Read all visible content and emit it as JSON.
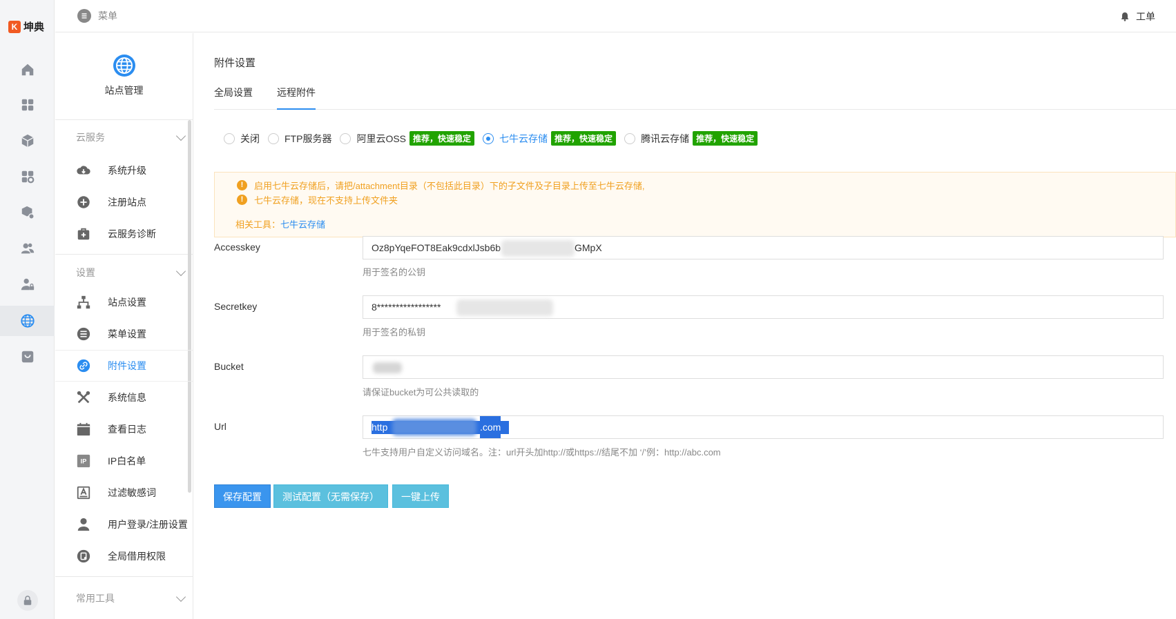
{
  "app": {
    "logo_mark": "K",
    "logo_name": "坤典"
  },
  "rail": {
    "icons": [
      "home-icon",
      "apps-grid-icon",
      "cube-icon",
      "apps-settings-icon",
      "box-settings-icon",
      "users-icon",
      "user-lock-icon",
      "globe-icon",
      "store-icon",
      "lock-icon"
    ],
    "active_index": 7
  },
  "topbar": {
    "menu_label": "菜单",
    "ticket_label": "工单"
  },
  "sidebar": {
    "header_title": "站点管理",
    "groups": [
      {
        "label": "云服务",
        "items": [
          "系统升级",
          "注册站点",
          "云服务诊断"
        ]
      },
      {
        "label": "设置",
        "items": [
          "站点设置",
          "菜单设置",
          "附件设置",
          "系统信息",
          "查看日志",
          "IP白名单",
          "过滤敏感词",
          "用户登录/注册设置",
          "全局借用权限"
        ]
      },
      {
        "label": "常用工具",
        "items": []
      }
    ],
    "active_item": "附件设置"
  },
  "main": {
    "title": "附件设置",
    "tabs": [
      "全局设置",
      "远程附件"
    ],
    "active_tab": "远程附件",
    "storage_options": [
      {
        "label": "关闭",
        "badge": "",
        "checked": false
      },
      {
        "label": "FTP服务器",
        "badge": "",
        "checked": false
      },
      {
        "label": "阿里云OSS",
        "badge": "推荐，快速稳定",
        "checked": false
      },
      {
        "label": "七牛云存储",
        "badge": "推荐，快速稳定",
        "checked": true
      },
      {
        "label": "腾讯云存储",
        "badge": "推荐，快速稳定",
        "checked": false
      }
    ],
    "notice": {
      "line1": "启用七牛云存储后，请把/attachment目录（不包括此目录）下的子文件及子目录上传至七牛云存储,",
      "line2": "七牛云存储，现在不支持上传文件夹",
      "tools_prefix": "相关工具：",
      "tools_link": "七牛云存储"
    },
    "fields": {
      "accesskey": {
        "label": "Accesskey",
        "value_start": "Oz8pYqeFOT8Eak9cdxlJsb6b",
        "value_end": "GMpX",
        "help": "用于签名的公钥"
      },
      "secretkey": {
        "label": "Secretkey",
        "value": "8*****************",
        "help": "用于签名的私钥"
      },
      "bucket": {
        "label": "Bucket",
        "value": "",
        "help": "请保证bucket为可公共读取的"
      },
      "url": {
        "label": "Url",
        "value_start": "http",
        "value_end": ".com",
        "help": "七牛支持用户自定义访问域名。注：url开头加http://或https://结尾不加 ‘/’例：http://abc.com"
      }
    },
    "buttons": {
      "save": "保存配置",
      "test": "测试配置（无需保存）",
      "upload": "一键上传"
    }
  },
  "colors": {
    "accent": "#2b8df0",
    "badge": "#21a300",
    "warning": "#f0a020",
    "primary_button": "#3a95ee",
    "info_button": "#5bc0de"
  }
}
